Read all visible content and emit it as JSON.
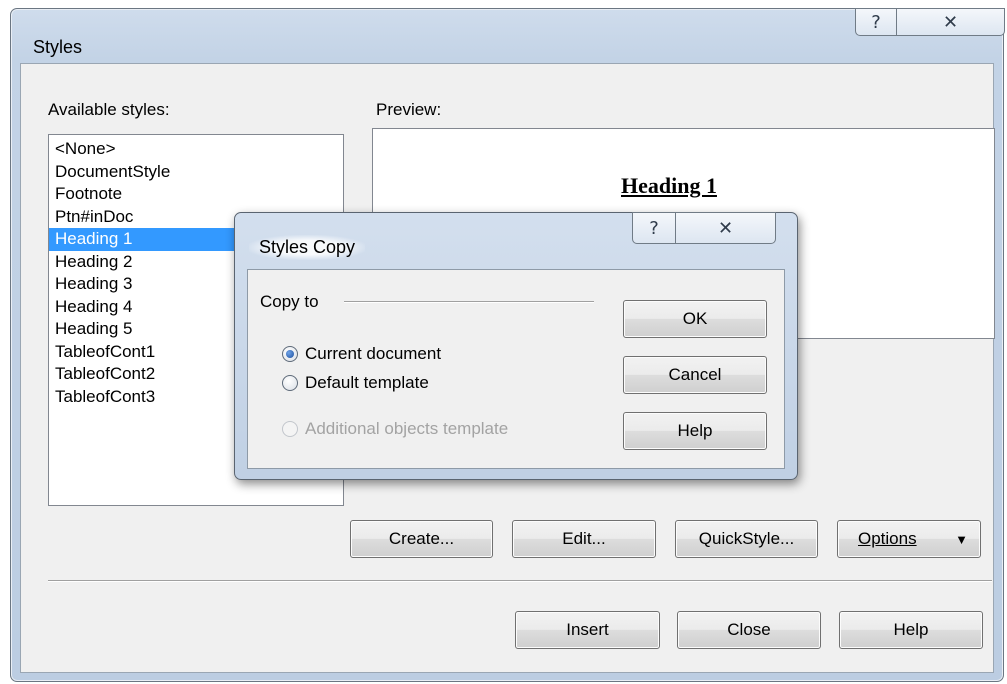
{
  "window": {
    "title": "Styles",
    "help_glyph": "?",
    "close_glyph": "✕"
  },
  "available_styles": {
    "label": "Available styles:",
    "items": [
      "<None>",
      "DocumentStyle",
      "Footnote",
      "Ptn#inDoc",
      "Heading 1",
      "Heading 2",
      "Heading 3",
      "Heading 4",
      "Heading 5",
      "TableofCont1",
      "TableofCont2",
      "TableofCont3"
    ],
    "selected": "Heading 1"
  },
  "preview": {
    "label": "Preview:",
    "heading_text": "Heading 1"
  },
  "buttons": {
    "create": "Create...",
    "edit": "Edit...",
    "quickstyle": "QuickStyle...",
    "options": "Options",
    "options_arrow": "▼",
    "insert": "Insert",
    "close": "Close",
    "help": "Help"
  },
  "copy_dialog": {
    "title": "Styles Copy",
    "help_glyph": "?",
    "close_glyph": "✕",
    "group_label": "Copy to",
    "options": [
      {
        "label": "Current document",
        "checked": true,
        "enabled": true
      },
      {
        "label": "Default template",
        "checked": false,
        "enabled": true
      },
      {
        "label": "Additional objects template",
        "checked": false,
        "enabled": false
      }
    ],
    "ok": "OK",
    "cancel": "Cancel",
    "help": "Help"
  },
  "colors": {
    "selection": "#3399ff",
    "window_frame": "#c3d3e6",
    "client": "#f0f0f0"
  }
}
